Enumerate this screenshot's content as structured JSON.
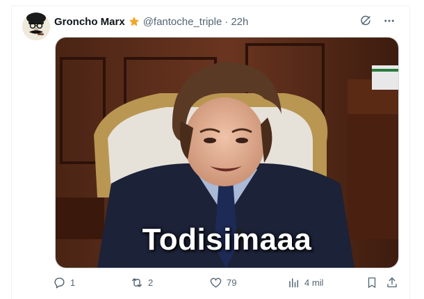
{
  "tweet": {
    "display_name": "Groncho Marx",
    "handle": "@fantoche_triple",
    "separator": "·",
    "time": "22h",
    "media": {
      "caption": "Todisimaaa"
    },
    "actions": {
      "replies": "1",
      "retweets": "2",
      "likes": "79",
      "views": "4 mil"
    }
  },
  "icons": {
    "verified": "gold-star-icon",
    "grok": "grok-icon",
    "more": "more-icon",
    "reply": "reply-icon",
    "retweet": "retweet-icon",
    "like": "heart-icon",
    "views": "views-icon",
    "bookmark": "bookmark-icon",
    "share": "share-icon"
  },
  "colors": {
    "text_primary": "#0f1419",
    "text_secondary": "#536471",
    "star": "#f2a626",
    "border": "#cfd9de"
  }
}
